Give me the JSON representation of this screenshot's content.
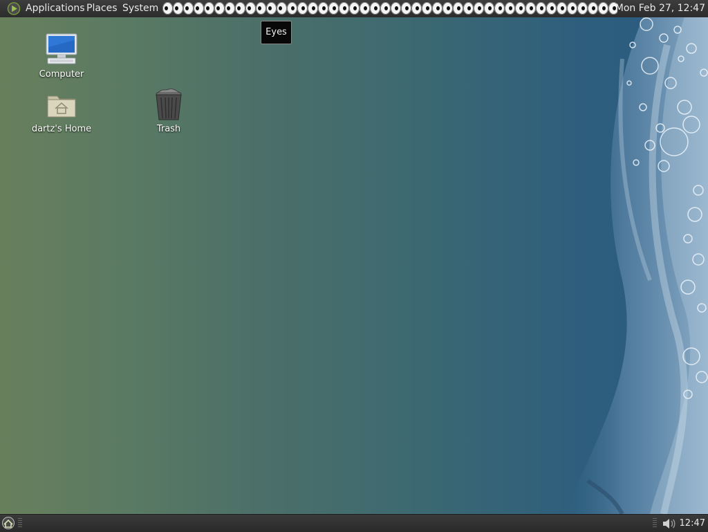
{
  "top_panel": {
    "menus": [
      "Applications",
      "Places",
      "System"
    ],
    "eyes_count": 44,
    "clock": "Mon Feb 27, 12:47"
  },
  "tooltip": {
    "text": "Eyes"
  },
  "desktop": {
    "icons": [
      {
        "label": "Computer",
        "icon": "computer-icon"
      },
      {
        "label": "dartz's Home",
        "icon": "home-folder-icon"
      },
      {
        "label": "Trash",
        "icon": "trash-icon"
      }
    ]
  },
  "bottom_panel": {
    "clock": "12:47",
    "volume_icon": "volume-icon"
  },
  "colors": {
    "panel": "#2c2c2c",
    "desktop_left": "#687f5c",
    "desktop_right": "#285a82"
  }
}
